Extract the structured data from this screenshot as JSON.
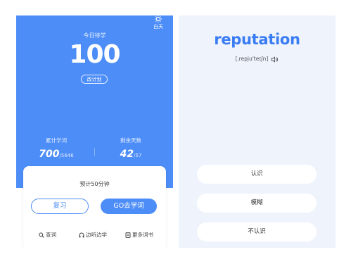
{
  "left": {
    "mode_label": "白天",
    "today_label": "今日待学",
    "today_count": "100",
    "plan_button": "改计划",
    "stats": {
      "learned_label": "累计学词",
      "learned_value": "700",
      "learned_total": "/5646",
      "days_label": "剩余天数",
      "days_value": "42",
      "days_total": "/57"
    },
    "card": {
      "estimate_prefix": "预计",
      "estimate_value": "50",
      "estimate_suffix": "分钟",
      "review_button": "复习",
      "go_button": "GO去学词",
      "links": {
        "lookup": "查词",
        "listen": "边听边学",
        "more_books": "更多词书"
      }
    }
  },
  "right": {
    "word": "reputation",
    "phonetic": "[ˌrepju'teɪʃn]",
    "choices": [
      "认识",
      "模糊",
      "不认识"
    ]
  },
  "colors": {
    "primary_blue": "#4d8df7",
    "word_blue": "#3a7cf3",
    "right_bg": "#eef3fc"
  },
  "icons": [
    "sun-icon",
    "search-icon",
    "headphones-icon",
    "book-icon",
    "speaker-icon"
  ]
}
